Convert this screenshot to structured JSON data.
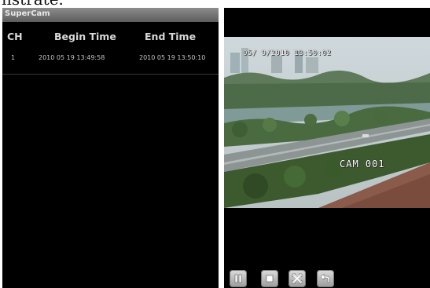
{
  "caption": "nstrate.",
  "app": {
    "title": "SuperCam"
  },
  "playback_list": {
    "columns": [
      "CH",
      "Begin Time",
      "End Time"
    ],
    "rows": [
      {
        "channel": "1",
        "begin": "2010 05 19 13:49:58",
        "end": "2010 05 19 13:50:10"
      }
    ]
  },
  "player": {
    "osd_timestamp": "05/ 9/2010 13:50:02",
    "camera_label": "CAM 001",
    "controls": [
      {
        "name": "pause",
        "icon": "pause-icon"
      },
      {
        "name": "stop",
        "icon": "stop-icon"
      },
      {
        "name": "fullscreen",
        "icon": "fullscreen-icon"
      },
      {
        "name": "back",
        "icon": "back-arrow-icon"
      }
    ]
  },
  "colors": {
    "screen_bg": "#000000",
    "titlebar": "#6e6e6e",
    "button": "#bdbdbd"
  }
}
